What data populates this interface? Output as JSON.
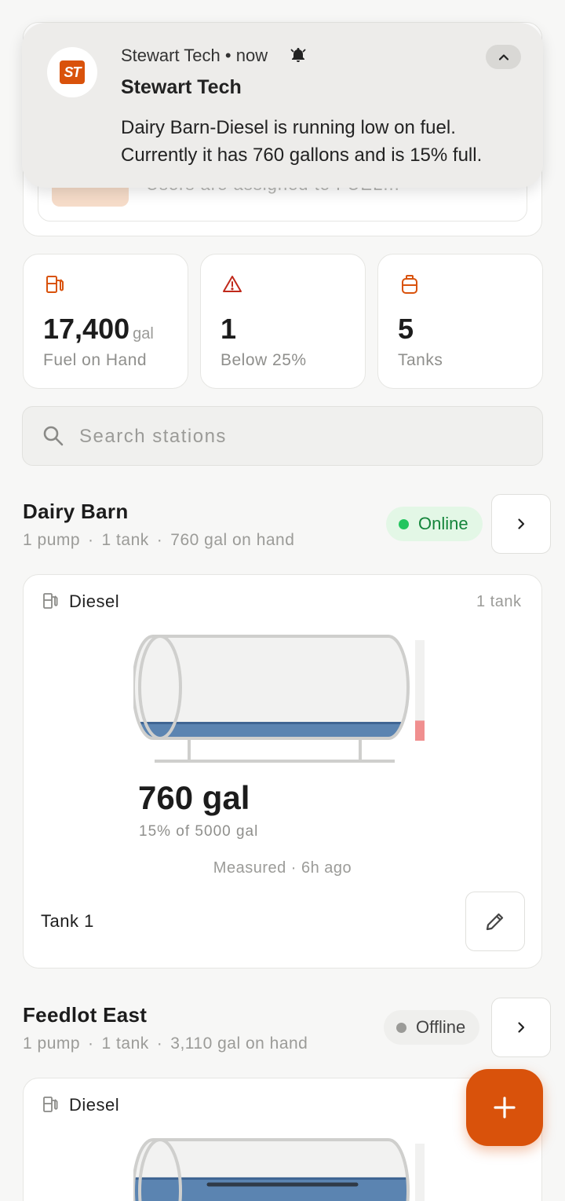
{
  "behind_card": {
    "snippet": "Users are assigned to FUEL..."
  },
  "notification": {
    "app_name": "Stewart Tech",
    "time": "now",
    "title": "Stewart Tech",
    "body": "Dairy Barn-Diesel is running low on fuel. Currently it has 760 gallons and is 15% full.",
    "logo_text": "ST",
    "accent": "#d9520b"
  },
  "stats": [
    {
      "icon": "fuel-pump-icon",
      "value": "17,400",
      "unit": "gal",
      "label": "Fuel on Hand"
    },
    {
      "icon": "warning-icon",
      "value": "1",
      "unit": "",
      "label": "Below 25%"
    },
    {
      "icon": "tank-icon",
      "value": "5",
      "unit": "",
      "label": "Tanks"
    }
  ],
  "search": {
    "placeholder": "Search stations"
  },
  "stations": [
    {
      "name": "Dairy Barn",
      "pumps": "1 pump",
      "tanks": "1 tank",
      "on_hand": "760 gal on hand",
      "status": "Online",
      "fuel": "Diesel",
      "tank_count": "1 tank",
      "tank": {
        "gallons": "760 gal",
        "detail": "15% of 5000 gal",
        "fill_fraction": 0.15,
        "measured": "Measured · 6h ago",
        "name": "Tank 1"
      }
    },
    {
      "name": "Feedlot East",
      "pumps": "1 pump",
      "tanks": "1 tank",
      "on_hand": "3,110 gal on hand",
      "status": "Offline",
      "fuel": "Diesel",
      "tank": {
        "fill_fraction": 0.62
      }
    }
  ],
  "colors": {
    "brand": "#d9520b",
    "online": "#22c55e",
    "tank_fill": "#5b84b1",
    "low_level": "#f08f8f"
  }
}
